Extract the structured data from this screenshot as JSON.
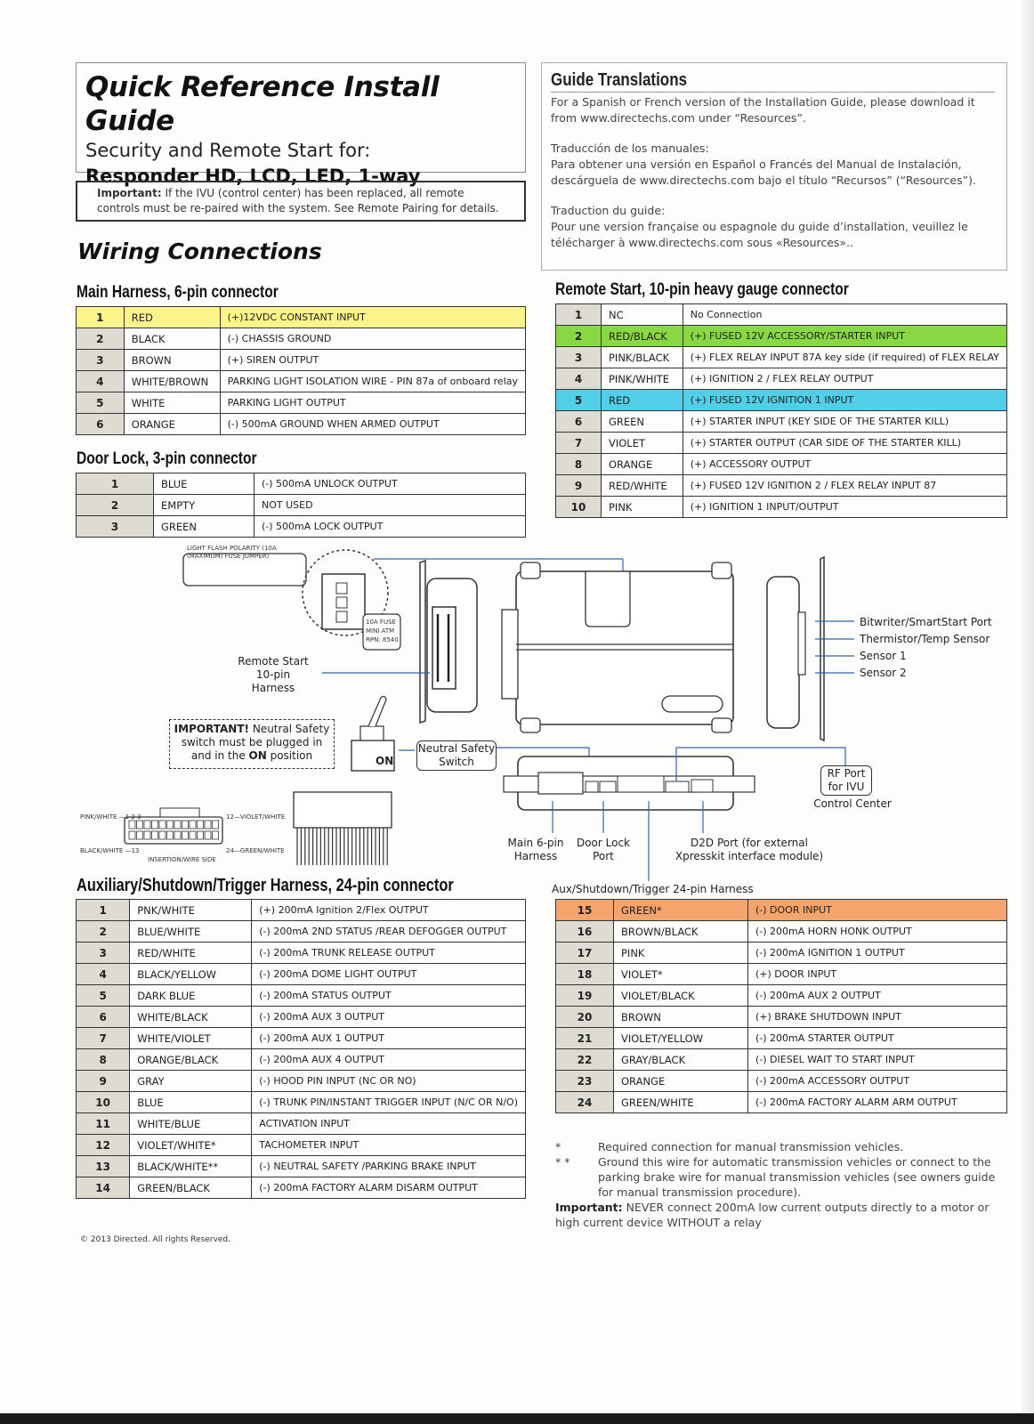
{
  "header": {
    "title": "Quick Reference Install Guide",
    "subtitle": "Security and Remote Start for:",
    "models": "Responder HD, LCD, LED, 1-way"
  },
  "important_notice": {
    "label": "Important:",
    "text": " If the IVU (control center) has been replaced, all remote controls must be re-paired with the system.  See Remote Pairing for details."
  },
  "wiring_title": "Wiring Connections",
  "translations": {
    "title": "Guide Translations",
    "english": "For a Spanish or French version of the Installation Guide, please download it from www.directechs.com under “Resources”.",
    "spanish_heading": "Traducción de los manuales:",
    "spanish": "Para obtener una versión en Español o Francés del Manual de Instalación, descárguela de www.directechs.com bajo el título “Recursos” (“Resources”).",
    "french_heading": "Traduction du guide:",
    "french": "Pour une version française ou espagnole du guide d’installation, veuillez le télécharger à www.directechs.com sous «Resources».."
  },
  "main_harness": {
    "title": "Main Harness, 6-pin connector",
    "rows": [
      {
        "pin": "1",
        "color": "RED",
        "desc": "(+)12VDC CONSTANT INPUT",
        "highlight": "yellow"
      },
      {
        "pin": "2",
        "color": "BLACK",
        "desc": "(-) CHASSIS GROUND"
      },
      {
        "pin": "3",
        "color": "BROWN",
        "desc": "(+) SIREN OUTPUT"
      },
      {
        "pin": "4",
        "color": "WHITE/BROWN",
        "desc": "PARKING LIGHT  ISOLATION WIRE - PIN 87a of onboard relay"
      },
      {
        "pin": "5",
        "color": "WHITE",
        "desc": "PARKING LIGHT OUTPUT"
      },
      {
        "pin": "6",
        "color": "ORANGE",
        "desc": "(-) 500mA GROUND WHEN ARMED OUTPUT"
      }
    ]
  },
  "door_lock": {
    "title": "Door Lock, 3-pin connector",
    "rows": [
      {
        "pin": "1",
        "color": "BLUE",
        "desc": "(-) 500mA UNLOCK OUTPUT"
      },
      {
        "pin": "2",
        "color": "EMPTY",
        "desc": "NOT USED"
      },
      {
        "pin": "3",
        "color": "GREEN",
        "desc": "(-) 500mA LOCK OUTPUT"
      }
    ]
  },
  "remote_start": {
    "title": "Remote Start, 10-pin heavy gauge connector",
    "rows": [
      {
        "pin": "1",
        "color": "NC",
        "desc": "No Connection"
      },
      {
        "pin": "2",
        "color": "RED/BLACK",
        "desc": "(+) FUSED 12V ACCESSORY/STARTER INPUT",
        "highlight": "green"
      },
      {
        "pin": "3",
        "color": "PINK/BLACK",
        "desc": "(+) FLEX RELAY INPUT 87A key side (if required) of FLEX RELAY"
      },
      {
        "pin": "4",
        "color": "PINK/WHITE",
        "desc": "(+) IGNITION 2 / FLEX RELAY OUTPUT"
      },
      {
        "pin": "5",
        "color": "RED",
        "desc": "(+) FUSED 12V IGNITION 1 INPUT",
        "highlight": "blue"
      },
      {
        "pin": "6",
        "color": "GREEN",
        "desc": "(+) STARTER INPUT (KEY SIDE OF THE STARTER KILL)"
      },
      {
        "pin": "7",
        "color": "VIOLET",
        "desc": "(+) STARTER OUTPUT  (CAR SIDE OF THE STARTER KILL)"
      },
      {
        "pin": "8",
        "color": "ORANGE",
        "desc": "(+) ACCESSORY OUTPUT"
      },
      {
        "pin": "9",
        "color": "RED/WHITE",
        "desc": "(+) FUSED 12V IGNITION 2 /  FLEX RELAY INPUT 87"
      },
      {
        "pin": "10",
        "color": "PINK",
        "desc": "(+) IGNITION 1 INPUT/OUTPUT"
      }
    ]
  },
  "diagram": {
    "fuse_jumper_label": "LIGHT FLASH POLARITY (10A (MAXIMUM) FUSE JUMPER)",
    "fuse_label": "10A FUSE MINI ATM RPN: 8540",
    "remote_start_harness": "Remote Start 10-pin Harness",
    "important_bold": "IMPORTANT!",
    "important_text1": " Neutral Safety switch must be plugged in and in the ",
    "important_on": "ON",
    "important_text2": " position",
    "switch_on": "ON",
    "neutral_safety": "Neutral Safety Switch",
    "bitwriter": "Bitwriter/SmartStart Port",
    "thermistor": "Thermistor/Temp Sensor",
    "sensor1": "Sensor 1",
    "sensor2": "Sensor 2",
    "rf_port": "RF Port for IVU",
    "control_center": "Control Center",
    "main_6pin": "Main 6-pin Harness",
    "door_lock_port": "Door Lock Port",
    "d2d_port": "D2D Port (for external Xpresskit interface module)",
    "aux_harness_label": "Aux/Shutdown/Trigger 24-pin Harness",
    "pinout_pink_white": "PINK/WHITE",
    "pinout_123": "1  2  3",
    "pinout_12": "12",
    "pinout_violet_white": "VIOLET/WHITE",
    "pinout_black_white": "BLACK/WHITE",
    "pinout_13": "13",
    "pinout_24": "24",
    "pinout_green_white": "GREEN/WHITE",
    "pinout_side": "INSERTION/WIRE SIDE"
  },
  "aux_harness": {
    "title": "Auxiliary/Shutdown/Trigger Harness, 24-pin connector",
    "rows_left": [
      {
        "pin": "1",
        "color": "PNK/WHITE",
        "desc": "(+) 200mA Ignition 2/Flex  OUTPUT"
      },
      {
        "pin": "2",
        "color": "BLUE/WHITE",
        "desc": "(-) 200mA 2ND STATUS /REAR DEFOGGER OUTPUT"
      },
      {
        "pin": "3",
        "color": "RED/WHITE",
        "desc": "(-) 200mA TRUNK RELEASE OUTPUT"
      },
      {
        "pin": "4",
        "color": "BLACK/YELLOW",
        "desc": "(-) 200mA DOME LIGHT OUTPUT"
      },
      {
        "pin": "5",
        "color": "DARK BLUE",
        "desc": "(-) 200mA STATUS OUTPUT"
      },
      {
        "pin": "6",
        "color": "WHITE/BLACK",
        "desc": "(-) 200mA AUX 3 OUTPUT"
      },
      {
        "pin": "7",
        "color": "WHITE/VIOLET",
        "desc": "(-) 200mA AUX 1 OUTPUT"
      },
      {
        "pin": "8",
        "color": "ORANGE/BLACK",
        "desc": "(-) 200mA AUX 4 OUTPUT"
      },
      {
        "pin": "9",
        "color": "GRAY",
        "desc": "(-) HOOD PIN INPUT (NC OR NO)"
      },
      {
        "pin": "10",
        "color": "BLUE",
        "desc": "(-) TRUNK PIN/INSTANT TRIGGER INPUT (N/C OR N/O)"
      },
      {
        "pin": "11",
        "color": "WHITE/BLUE",
        "desc": "ACTIVATION INPUT"
      },
      {
        "pin": "12",
        "color": "VIOLET/WHITE*",
        "desc": "TACHOMETER INPUT"
      },
      {
        "pin": "13",
        "color": "BLACK/WHITE**",
        "desc": "(-) NEUTRAL SAFETY /PARKING BRAKE INPUT"
      },
      {
        "pin": "14",
        "color": "GREEN/BLACK",
        "desc": "(-) 200mA FACTORY ALARM DISARM OUTPUT"
      }
    ],
    "rows_right": [
      {
        "pin": "15",
        "color": "GREEN*",
        "desc": "(-) DOOR INPUT",
        "highlight": "orange"
      },
      {
        "pin": "16",
        "color": "BROWN/BLACK",
        "desc": "(-) 200mA HORN HONK OUTPUT"
      },
      {
        "pin": "17",
        "color": "PINK",
        "desc": "(-) 200mA IGNITION 1 OUTPUT"
      },
      {
        "pin": "18",
        "color": "VIOLET*",
        "desc": "(+) DOOR INPUT"
      },
      {
        "pin": "19",
        "color": "VIOLET/BLACK",
        "desc": "(-) 200mA AUX 2 OUTPUT"
      },
      {
        "pin": "20",
        "color": "BROWN",
        "desc": "(+) BRAKE SHUTDOWN INPUT"
      },
      {
        "pin": "21",
        "color": "VIOLET/YELLOW",
        "desc": "(-) 200mA STARTER OUTPUT"
      },
      {
        "pin": "22",
        "color": "GRAY/BLACK",
        "desc": "(-) DIESEL WAIT TO START INPUT"
      },
      {
        "pin": "23",
        "color": "ORANGE",
        "desc": "(-) 200mA ACCESSORY OUTPUT"
      },
      {
        "pin": "24",
        "color": "GREEN/WHITE",
        "desc": "(-) 200mA FACTORY ALARM ARM OUTPUT"
      }
    ]
  },
  "footnotes": {
    "single_mark": "*",
    "single_text": "Required connection for manual transmission vehicles.",
    "double_mark": "* *",
    "double_text": "Ground this wire for automatic transmission vehicles or connect to the parking brake wire for manual transmission vehicles (see owners guide for manual transmission procedure).",
    "important_label": "Important:",
    "important_text": " NEVER connect 200mA low current outputs directly to a motor or high current device WITHOUT a relay"
  },
  "copyright": "© 2013 Directed. All rights Reserved.",
  "highlight_colors": {
    "yellow": "#faf064",
    "green": "#88d844",
    "blue": "#52cfe8",
    "orange": "#f4a46c"
  }
}
